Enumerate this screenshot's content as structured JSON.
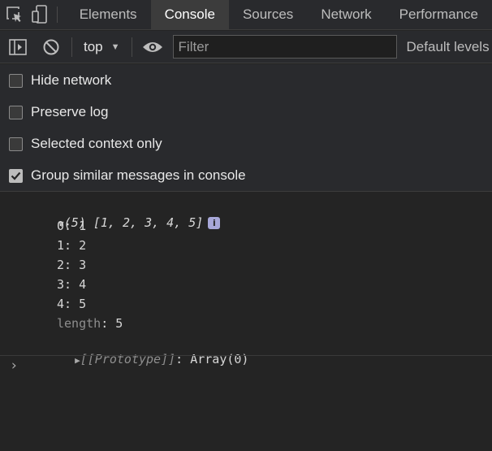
{
  "devtools": {
    "tabs": [
      {
        "label": "Elements"
      },
      {
        "label": "Console"
      },
      {
        "label": "Sources"
      },
      {
        "label": "Network"
      },
      {
        "label": "Performance"
      }
    ],
    "active_tab": "Console"
  },
  "toolbar": {
    "context": "top",
    "filter_placeholder": "Filter",
    "levels": "Default levels"
  },
  "settings": {
    "options": [
      {
        "label": "Hide network",
        "checked": false
      },
      {
        "label": "Preserve log",
        "checked": false
      },
      {
        "label": "Selected context only",
        "checked": false
      },
      {
        "label": "Group similar messages in console",
        "checked": true
      }
    ]
  },
  "output": {
    "summary": "(5) [1, 2, 3, 4, 5]",
    "info_badge": "i",
    "entries": [
      {
        "key": "0",
        "value": "1"
      },
      {
        "key": "1",
        "value": "2"
      },
      {
        "key": "2",
        "value": "3"
      },
      {
        "key": "3",
        "value": "4"
      },
      {
        "key": "4",
        "value": "5"
      }
    ],
    "length_key": "length",
    "length_value": "5",
    "prototype_key": "[[Prototype]]",
    "prototype_value": "Array(0)",
    "prompt": "›"
  }
}
